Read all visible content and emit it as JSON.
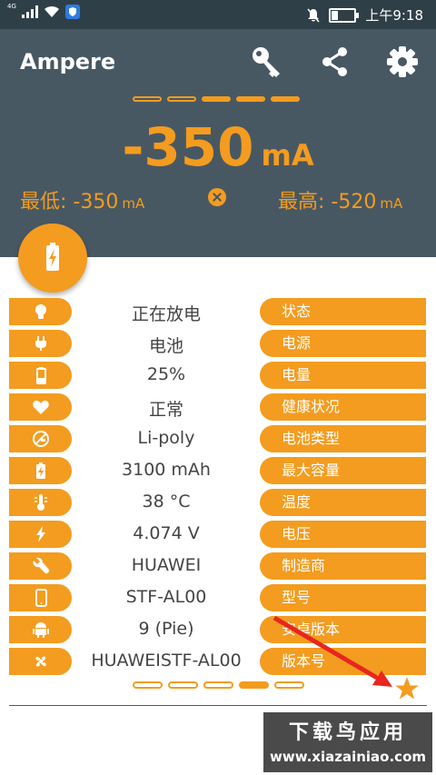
{
  "status_bar": {
    "network_label": "4G",
    "time": "上午9:18"
  },
  "header": {
    "title": "Ampere",
    "current_value": "-350",
    "current_unit": "mA",
    "min_label": "最低: -350",
    "min_unit": "mA",
    "max_label": "最高: -520",
    "max_unit": "mA",
    "page_active": 3,
    "page_count": 5
  },
  "rows": [
    {
      "icon": "bulb-icon",
      "value": "正在放电",
      "label": "状态"
    },
    {
      "icon": "plug-icon",
      "value": "电池",
      "label": "电源"
    },
    {
      "icon": "battery-icon",
      "value": "25%",
      "label": "电量"
    },
    {
      "icon": "heart-icon",
      "value": "正常",
      "label": "健康状况"
    },
    {
      "icon": "battery-type-icon",
      "value": "Li-poly",
      "label": "电池类型"
    },
    {
      "icon": "battery-charging-icon",
      "value": "3100 mAh",
      "label": "最大容量"
    },
    {
      "icon": "thermometer-icon",
      "value": "38 °C",
      "label": "温度"
    },
    {
      "icon": "lightning-icon",
      "value": "4.074 V",
      "label": "电压"
    },
    {
      "icon": "wrench-icon",
      "value": "HUAWEI",
      "label": "制造商"
    },
    {
      "icon": "phone-icon",
      "value": "STF-AL00",
      "label": "型号"
    },
    {
      "icon": "android-icon",
      "value": "9 (Pie)",
      "label": "安卓版本"
    },
    {
      "icon": "fan-icon",
      "value": "HUAWEISTF-AL00",
      "label": "版本号"
    }
  ],
  "watermark": {
    "title": "下载鸟应用",
    "url": "www.xiazainiao.com"
  },
  "colors": {
    "accent": "#f39c1f",
    "header_bg": "#485863",
    "status_bg": "#2f3f48"
  }
}
